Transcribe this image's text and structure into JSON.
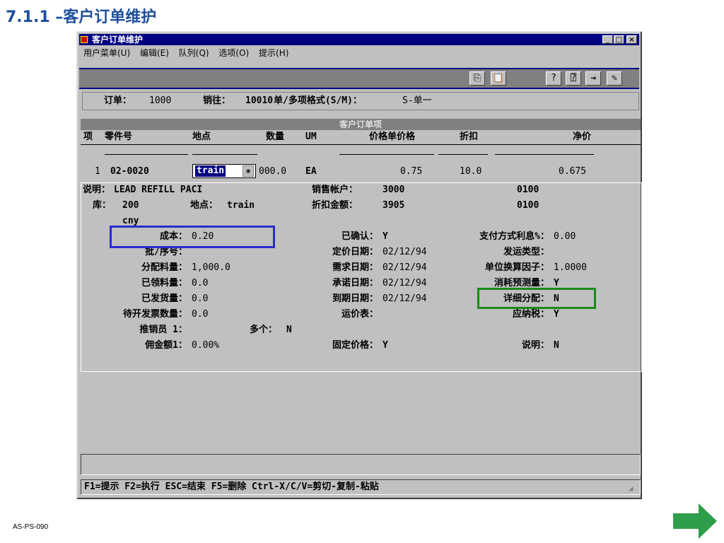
{
  "slide": {
    "title": "7.1.1 –客户订单维护",
    "footer": "AS-PS-090",
    "accent_color": "#1f4e9c",
    "arrow_color": "#2e9e4a"
  },
  "window": {
    "title": "客户订单维护",
    "controls": [
      "_",
      "□",
      "×"
    ],
    "menu": [
      "用户菜单(U)",
      "编辑(E)",
      "队列(Q)",
      "选项(O)",
      "提示(H)"
    ],
    "toolbar_icons": [
      "copy-icon",
      "paste-icon",
      "help-icon",
      "context-help-icon",
      "exit-icon",
      "edit-icon"
    ]
  },
  "header": {
    "order_label": "订单：",
    "order_value": "1000",
    "sold_to_label": "销往：",
    "sold_to_value": "10010",
    "format_label": "单/多项格式(S/M)：",
    "format_value": "S-单一"
  },
  "lines": {
    "title": "客户订单项",
    "columns": [
      "项",
      "零件号",
      "地点",
      "数量",
      "UM",
      "价格单价格",
      "折扣",
      "净价"
    ],
    "row": {
      "item": "1",
      "part": "02-0020",
      "site": "train",
      "qty": "000.0",
      "um": "EA",
      "price": "0.75",
      "discount": "10.0",
      "net": "0.675"
    }
  },
  "detail": {
    "desc_label": "说明：",
    "desc_value": "LEAD REFILL PACI",
    "sales_acct_label": "销售帐户：",
    "sales_acct_value": "3000",
    "sales_acct_sub": "0100",
    "loc_label": "库：",
    "loc_value": "200",
    "site_label": "地点：",
    "site_value": "train",
    "disc_acct_label": "折扣金额：",
    "disc_acct_value": "3905",
    "disc_acct_sub": "0100",
    "currency": "cny",
    "cost_label": "成本：",
    "cost_value": "0.20",
    "confirmed_label": "已确认：",
    "confirmed_value": "Y",
    "pay_int_label": "支付方式利息%：",
    "pay_int_value": "0.00",
    "lot_label": "批/序号：",
    "pricing_date_label": "定价日期：",
    "pricing_date_value": "02/12/94",
    "ship_type_label": "发运类型：",
    "alloc_label": "分配料量：",
    "alloc_value": "1,000.0",
    "req_date_label": "需求日期：",
    "req_date_value": "02/12/94",
    "um_conv_label": "单位换算因子：",
    "um_conv_value": "1.0000",
    "picked_label": "已领料量：",
    "picked_value": "0.0",
    "promise_label": "承诺日期：",
    "promise_value": "02/12/94",
    "consume_label": "消耗预测量：",
    "consume_value": "Y",
    "shipped_label": "已发货量：",
    "shipped_value": "0.0",
    "due_label": "到期日期：",
    "due_value": "02/12/94",
    "detail_alloc_label": "详细分配：",
    "detail_alloc_value": "N",
    "to_invoice_label": "待开发票数量：",
    "to_invoice_value": "0.0",
    "freight_label": "运价表：",
    "taxable_label": "应纳税：",
    "taxable_value": "Y",
    "slsp_label": "推销员 1：",
    "multi_label": "多个：",
    "multi_value": "N",
    "comm_label": "佣金额1：",
    "comm_value": "0.00%",
    "fixed_price_label": "固定价格：",
    "fixed_price_value": "Y",
    "comments_label": "说明：",
    "comments_value": "N",
    "highlight_cost_color": "#2b2bd0",
    "highlight_alloc_color": "#1a8a1a"
  },
  "status": {
    "text": "F1=提示 F2=执行 ESC=结束 F5=删除 Ctrl-X/C/V=剪切-复制-粘贴"
  }
}
